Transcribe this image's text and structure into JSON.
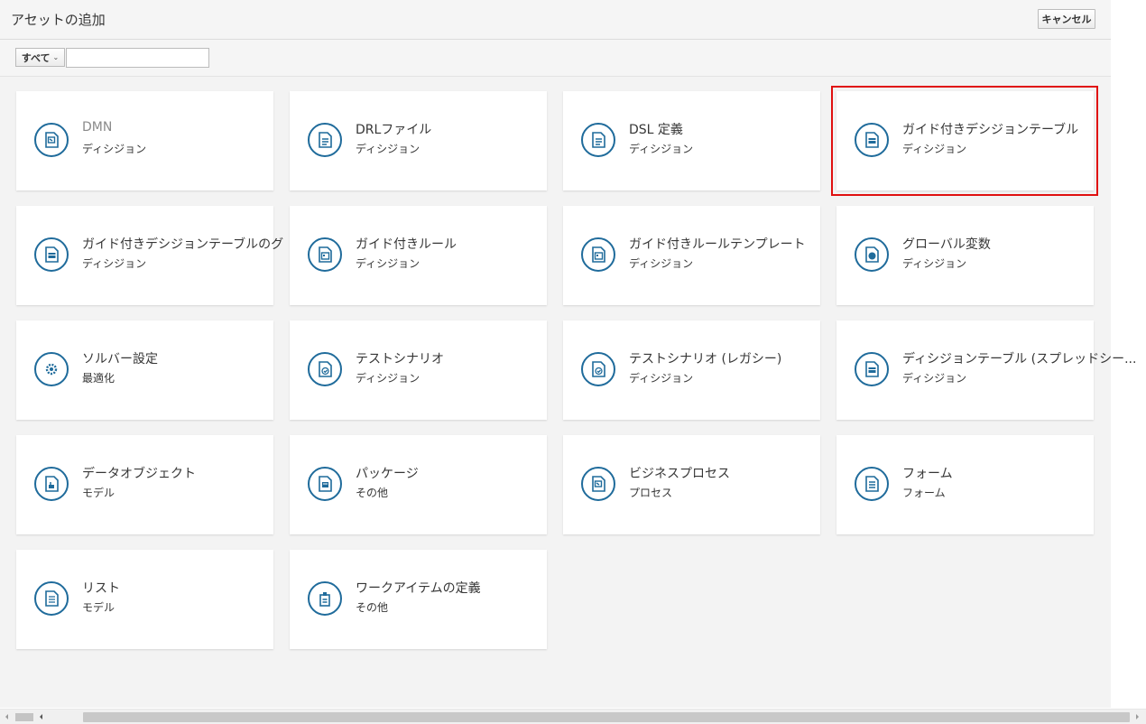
{
  "header": {
    "title": "アセットの追加",
    "cancel_label": "キャンセル"
  },
  "filter": {
    "dropdown_label": "すべて",
    "search_value": "",
    "search_placeholder": ""
  },
  "colors": {
    "icon_ring": "#1f6b9b",
    "highlight_border": "#e01010",
    "panel_background": "#f3f3f3"
  },
  "assets": [
    {
      "name": "DMN",
      "category": "ディシジョン",
      "icon": "dmn-icon",
      "muted": true
    },
    {
      "name": "DRLファイル",
      "category": "ディシジョン",
      "icon": "drl-file-icon",
      "muted": false
    },
    {
      "name": "DSL 定義",
      "category": "ディシジョン",
      "icon": "dsl-definition-icon",
      "muted": false
    },
    {
      "name": "ガイド付きデシジョンテーブル",
      "category": "ディシジョン",
      "icon": "guided-decision-table-icon",
      "muted": false
    },
    {
      "name": "ガイド付きデシジョンテーブルのグ",
      "category": "ディシジョン",
      "icon": "guided-decision-table-graph-icon",
      "muted": false
    },
    {
      "name": "ガイド付きルール",
      "category": "ディシジョン",
      "icon": "guided-rule-icon",
      "muted": false
    },
    {
      "name": "ガイド付きルールテンプレート",
      "category": "ディシジョン",
      "icon": "guided-rule-template-icon",
      "muted": false
    },
    {
      "name": "グローバル変数",
      "category": "ディシジョン",
      "icon": "global-variable-icon",
      "muted": false
    },
    {
      "name": "ソルバー設定",
      "category": "最適化",
      "icon": "solver-config-icon",
      "muted": false
    },
    {
      "name": "テストシナリオ",
      "category": "ディシジョン",
      "icon": "test-scenario-icon",
      "muted": false
    },
    {
      "name": "テストシナリオ (レガシー)",
      "category": "ディシジョン",
      "icon": "test-scenario-legacy-icon",
      "muted": false
    },
    {
      "name": "ディシジョンテーブル (スプレッドシー...",
      "category": "ディシジョン",
      "icon": "spreadsheet-decision-table-icon",
      "muted": false
    },
    {
      "name": "データオブジェクト",
      "category": "モデル",
      "icon": "data-object-icon",
      "muted": false
    },
    {
      "name": "パッケージ",
      "category": "その他",
      "icon": "package-icon",
      "muted": false
    },
    {
      "name": "ビジネスプロセス",
      "category": "プロセス",
      "icon": "business-process-icon",
      "muted": false
    },
    {
      "name": "フォーム",
      "category": "フォーム",
      "icon": "form-icon",
      "muted": false
    },
    {
      "name": "リスト",
      "category": "モデル",
      "icon": "list-icon",
      "muted": false
    },
    {
      "name": "ワークアイテムの定義",
      "category": "その他",
      "icon": "work-item-definition-icon",
      "muted": false
    }
  ],
  "highlighted_asset": "ガイド付きデシジョンテーブル"
}
